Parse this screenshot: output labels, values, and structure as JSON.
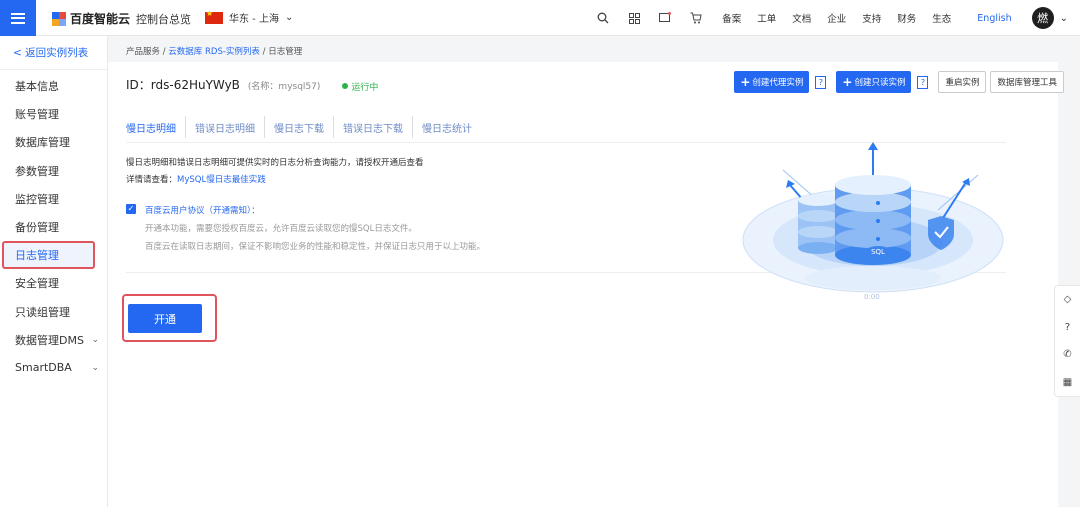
{
  "topbar": {
    "logo_text": "百度智能云",
    "console": "控制台总览",
    "region": "华东 - 上海",
    "nav": [
      "备案",
      "工单",
      "文档",
      "企业",
      "支持",
      "财务",
      "生态"
    ],
    "lang": "English",
    "avatar": "燃"
  },
  "sidebar": {
    "back": "< 返回实例列表",
    "items": [
      {
        "label": "基本信息"
      },
      {
        "label": "账号管理"
      },
      {
        "label": "数据库管理"
      },
      {
        "label": "参数管理"
      },
      {
        "label": "监控管理"
      },
      {
        "label": "备份管理"
      },
      {
        "label": "日志管理"
      },
      {
        "label": "安全管理"
      },
      {
        "label": "只读组管理"
      },
      {
        "label": "数据管理DMS"
      },
      {
        "label": "SmartDBA"
      }
    ]
  },
  "breadcrumb": {
    "part1": "产品服务",
    "sep": " / ",
    "part2": "云数据库 RDS-实例列表",
    "part3": "日志管理"
  },
  "instance": {
    "id": "ID：rds-62HuYWyB",
    "name": "(名称：mysql57)",
    "status": "运行中"
  },
  "actions": {
    "create_proxy": "创建代理实例",
    "create_readonly": "创建只读实例",
    "restart": "重启实例",
    "db_tool": "数据库管理工具",
    "help": "?"
  },
  "tabs": [
    "慢日志明细",
    "错误日志明细",
    "慢日志下载",
    "错误日志下载",
    "慢日志统计"
  ],
  "desc": {
    "line1": "慢日志明细和错误日志明细可提供实时的日志分析查询能力，请授权开通后查看",
    "line2_prefix": "详情请查看：",
    "line2_link": "MySQL慢日志最佳实践"
  },
  "agreement": {
    "title": "百度云用户协议（开通需知）：",
    "line2": "开通本功能，需要您授权百度云，允许百度云读取您的慢SQL日志文件。",
    "line3": "百度云在读取日志期间，保证不影响您业务的性能和稳定性，并保证日志只用于以上功能。"
  },
  "open_button": "开通",
  "illustration": {
    "label": "SQL",
    "timecode": "0:00"
  },
  "colors": {
    "accent": "#2468f2",
    "highlight": "#e0555b",
    "running": "#2bb24c"
  }
}
